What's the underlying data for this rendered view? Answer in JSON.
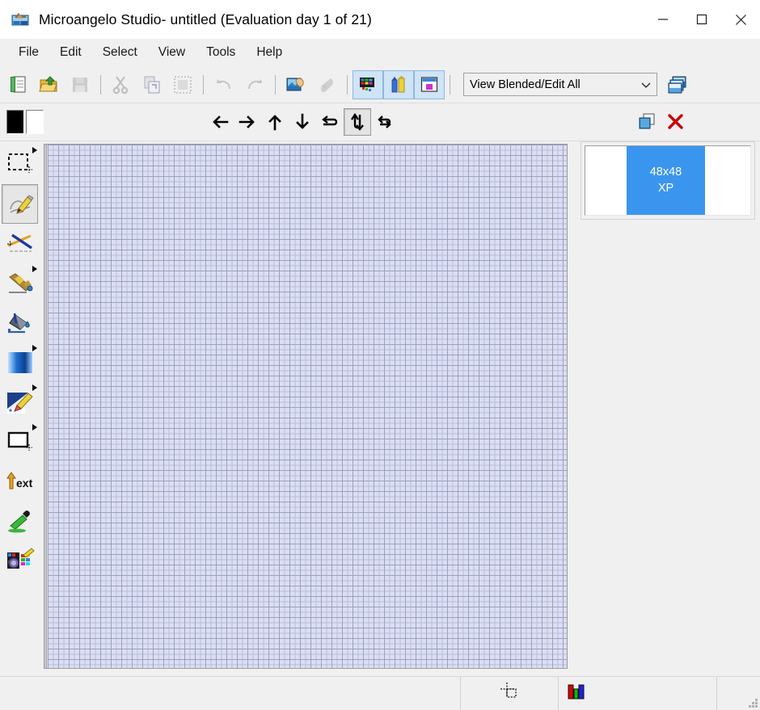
{
  "window": {
    "title": "Microangelo Studio- untitled  (Evaluation day 1 of 21)",
    "app_icon": "microangelo-app-icon",
    "controls": {
      "minimize": "minimize-icon",
      "maximize": "maximize-icon",
      "close": "close-icon"
    }
  },
  "menubar": {
    "items": [
      {
        "label": "File"
      },
      {
        "label": "Edit"
      },
      {
        "label": "Select"
      },
      {
        "label": "View"
      },
      {
        "label": "Tools"
      },
      {
        "label": "Help"
      }
    ]
  },
  "toolbar_main": {
    "buttons": [
      {
        "name": "new-document-button",
        "icon": "new-document-icon",
        "enabled": true
      },
      {
        "name": "open-file-button",
        "icon": "open-folder-icon",
        "enabled": true
      },
      {
        "name": "save-button",
        "icon": "save-icon",
        "enabled": false
      },
      {
        "name": "cut-button",
        "icon": "scissors-icon",
        "enabled": false
      },
      {
        "name": "copy-button",
        "icon": "copy-icon",
        "enabled": false
      },
      {
        "name": "paste-button",
        "icon": "paste-icon",
        "enabled": false
      },
      {
        "name": "undo-button",
        "icon": "undo-arrow-icon",
        "enabled": false
      },
      {
        "name": "redo-button",
        "icon": "redo-arrow-icon",
        "enabled": false
      },
      {
        "name": "import-image-button",
        "icon": "import-image-icon",
        "enabled": true
      },
      {
        "name": "pointer-button",
        "icon": "pointer-hand-icon",
        "enabled": false
      }
    ],
    "toggles": [
      {
        "name": "palette-view-toggle",
        "icon": "color-palette-grid-icon",
        "pressed": true
      },
      {
        "name": "pencils-toggle",
        "icon": "pencils-icon",
        "pressed": true
      },
      {
        "name": "properties-panel-toggle",
        "icon": "properties-window-icon",
        "pressed": true
      }
    ],
    "view_mode": {
      "label": "View Blended/Edit All",
      "dropdown_icon": "chevron-down-icon"
    },
    "layers_button": {
      "name": "image-layers-button",
      "icon": "image-stack-icon"
    }
  },
  "toolbar_edit": {
    "colors": {
      "foreground": "#000000",
      "background": "#ffffff"
    },
    "transform_buttons": [
      {
        "name": "shift-left-button",
        "icon": "arrow-left-icon",
        "pressed": false
      },
      {
        "name": "shift-right-button",
        "icon": "arrow-right-icon",
        "pressed": false
      },
      {
        "name": "shift-up-button",
        "icon": "arrow-up-icon",
        "pressed": false
      },
      {
        "name": "shift-down-button",
        "icon": "arrow-down-icon",
        "pressed": false
      },
      {
        "name": "flip-horizontal-button",
        "icon": "flip-horizontal-icon",
        "pressed": false
      },
      {
        "name": "flip-vertical-button",
        "icon": "flip-vertical-icon",
        "pressed": true
      },
      {
        "name": "rotate-button",
        "icon": "rotate-icon",
        "pressed": false
      }
    ],
    "right_buttons": [
      {
        "name": "duplicate-image-button",
        "icon": "duplicate-image-icon"
      },
      {
        "name": "delete-image-button",
        "icon": "red-x-delete-icon"
      }
    ]
  },
  "tool_palette": {
    "tools": [
      {
        "name": "tool-select-rectangle",
        "icon": "marquee-select-icon",
        "active": false,
        "has_flyout": true
      },
      {
        "name": "tool-pencil",
        "icon": "pencil-icon",
        "active": true,
        "has_flyout": false
      },
      {
        "name": "tool-line",
        "icon": "line-icon",
        "active": false,
        "has_flyout": false
      },
      {
        "name": "tool-brush",
        "icon": "brush-icon",
        "active": false,
        "has_flyout": true
      },
      {
        "name": "tool-fill",
        "icon": "paint-bucket-icon",
        "active": false,
        "has_flyout": false
      },
      {
        "name": "tool-gradient",
        "icon": "gradient-icon",
        "active": false,
        "has_flyout": true
      },
      {
        "name": "tool-airbrush",
        "icon": "airbrush-icon",
        "active": false,
        "has_flyout": true
      },
      {
        "name": "tool-rectangle",
        "icon": "rectangle-shape-icon",
        "active": false,
        "has_flyout": true
      },
      {
        "name": "tool-text",
        "icon": "text-tool-icon",
        "active": false,
        "has_flyout": false
      },
      {
        "name": "tool-eyedropper",
        "icon": "eyedropper-icon",
        "active": false,
        "has_flyout": false
      },
      {
        "name": "tool-palette-editor",
        "icon": "palette-editor-icon",
        "active": false,
        "has_flyout": false
      }
    ]
  },
  "canvas": {
    "name": "icon-edit-canvas",
    "grid_visible": true,
    "background_color": "#dcdef2",
    "grid_minor_color": "#b9bdd8",
    "grid_major_color": "#9aa0c4"
  },
  "image_list": {
    "items": [
      {
        "label_line1": "48x48",
        "label_line2": "XP",
        "selected": true,
        "color": "#3a95ef"
      }
    ]
  },
  "statusbar": {
    "cells": [
      {
        "name": "cursor-position-cell",
        "icon": "crosshair-selection-icon",
        "text": ""
      },
      {
        "name": "color-depth-cell",
        "icon": "rgb-bars-icon",
        "text": ""
      },
      {
        "name": "message-cell",
        "text": ""
      }
    ],
    "grip_icon": "resize-grip-icon"
  }
}
